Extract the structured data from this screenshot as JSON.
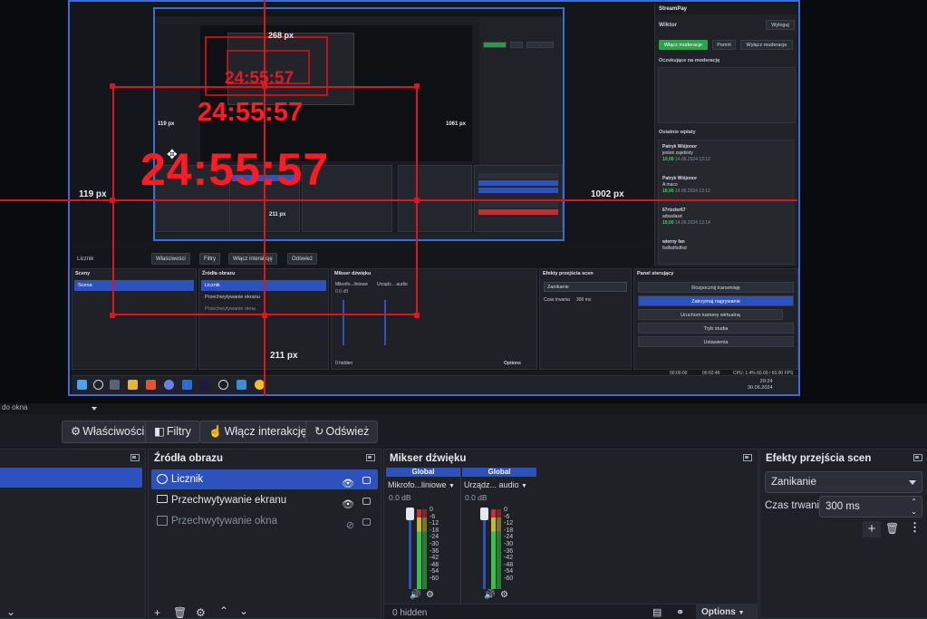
{
  "outer": {
    "toolbar_buttons": [
      "Właściwości",
      "Filtry",
      "Włącz interakcję",
      "Odśwież"
    ],
    "source_label": "Licznik",
    "scene_label": "Scena",
    "docks": {
      "scenes_title": "Sceny",
      "sources_title": "Źródła obrazu",
      "mixer_title": "Mikser dźwięku",
      "transitions_title": "Efekty przejścia scen",
      "controls_title": "Panel sterujący"
    },
    "sources": [
      "Licznik",
      "Przechwytywanie ekranu",
      "Przechwytywanie okna"
    ],
    "mixer": {
      "global": "Global",
      "ch1": "Mikrofo...liniowe",
      "ch2": "Urządz... audio",
      "db": "0.0 dB",
      "hidden": "0 hidden",
      "options": "Options"
    },
    "transition": {
      "value": "Zanikanie",
      "duration_label": "Czas trwania",
      "duration": "300 ms"
    },
    "controls": [
      "Rozpocznij transmisję",
      "Zatrzymaj nagrywanie",
      "Uruchom kamerę wirtualną",
      "Tryb studia",
      "Ustawienia"
    ],
    "status": {
      "time1": "00:00:00",
      "time2": "00:02:46",
      "cpu": "CPU: 1.4%",
      "fps": "60.00 / 60.00 FPS"
    },
    "clock": {
      "time": "20:24",
      "date": "30.06.2024"
    }
  },
  "streampay": {
    "title": "StreamPay",
    "user": "Wiktor",
    "logout": "Wyloguj",
    "btn_enable": "Włącz moderacje",
    "btn_skip": "Pomiń",
    "btn_disable": "Wyłącz moderacje",
    "pending": "Oczekujące na moderację",
    "recent": "Ostatnie wpłaty",
    "donations": [
      {
        "name": "Patryk Wiśjonor",
        "msg": "jesteś zajebisty",
        "amount": "10,00",
        "time": "14.06.2024 13:12"
      },
      {
        "name": "Patryk Wiśjonor",
        "msg": "A maco",
        "amount": "10,00",
        "time": "14.06.2024 13:12"
      },
      {
        "name": "67rizzler67",
        "msg": "adsadasd",
        "amount": "10,00",
        "time": "14.06.2024 13:14"
      },
      {
        "name": "wierny fan",
        "msg": "fsdfsdfsdfsd",
        "amount": "10,00",
        "time": "14.06.2024 13:14"
      }
    ]
  },
  "measure": {
    "clock": "24:55:57",
    "px_119": "119 px",
    "px_1002": "1002 px",
    "px_211": "211 px",
    "px_268": "268 px",
    "px_1061": "1061 px"
  },
  "main": {
    "dropdown": "do okna",
    "toolbar": {
      "properties": "Właściwości",
      "filters": "Filtry",
      "interact": "Włącz interakcję",
      "refresh": "Odśwież"
    },
    "sources_title": "Źródła obrazu",
    "sources": [
      {
        "label": "Licznik"
      },
      {
        "label": "Przechwytywanie ekranu"
      },
      {
        "label": "Przechwytywanie okna"
      }
    ],
    "mixer": {
      "title": "Mikser dźwięku",
      "ch1_head": "Global",
      "ch1_name": "Mikrofo...liniowe",
      "ch1_db": "0.0 dB",
      "ch2_head": "Global",
      "ch2_name": "Urządz... audio",
      "ch2_db": "0.0 dB",
      "scale": [
        "0",
        "-6",
        "-12",
        "-18",
        "-24",
        "-30",
        "-36",
        "-42",
        "-48",
        "-54",
        "-60"
      ],
      "hidden": "0 hidden",
      "options": "Options"
    },
    "transitions": {
      "title": "Efekty przejścia scen",
      "value": "Zanikanie",
      "duration_label": "Czas trwania",
      "duration": "300 ms"
    }
  },
  "colors": {
    "accent": "#2d52bd",
    "overlay": "#e0141e",
    "green": "#2aa24e"
  }
}
